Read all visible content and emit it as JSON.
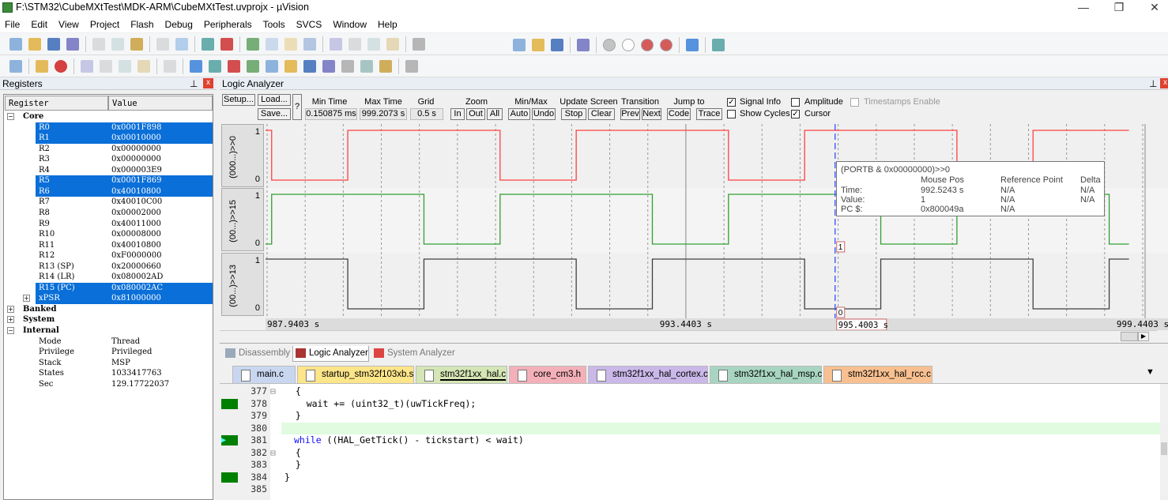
{
  "window": {
    "title": "F:\\STM32\\CubeMXtTest\\MDK-ARM\\CubeMXtTest.uvprojx - µVision",
    "min": "—",
    "max": "❐",
    "close": "✕"
  },
  "menu": [
    "File",
    "Edit",
    "View",
    "Project",
    "Flash",
    "Debug",
    "Peripherals",
    "Tools",
    "SVCS",
    "Window",
    "Help"
  ],
  "toolbar1_icons": [
    "new-file-icon",
    "open-icon",
    "save-icon",
    "save-all-icon",
    "|",
    "cut-icon",
    "copy-icon",
    "paste-icon",
    "|",
    "undo-icon",
    "redo-icon",
    "|",
    "back-icon",
    "forward-icon",
    "|",
    "bookmark-icon",
    "prev-bookmark-icon",
    "next-bookmark-icon",
    "clear-bookmarks-icon",
    "|",
    "indent-icon",
    "unindent-icon",
    "comment-icon",
    "uncomment-icon",
    "|",
    "find-in-files-icon"
  ],
  "toolbar1_right_icons": [
    "find-dropdown-icon",
    "incremental-find-icon",
    "debug-session-icon",
    "|",
    "start-debug-icon",
    "|",
    "breakpoint-icon",
    "disabled-breakpoint-icon",
    "kill-breakpoints-icon",
    "kill-all-icon",
    "|",
    "window-layout-icon",
    "|",
    "configure-icon"
  ],
  "toolbar2_icons": [
    "reset-icon",
    "|",
    "run-icon",
    "stop-icon",
    "|",
    "step-into-icon",
    "step-over-icon",
    "step-out-icon",
    "run-to-cursor-icon",
    "|",
    "show-next-statement-icon",
    "|",
    "command-window-icon",
    "disassembly-window-icon",
    "symbols-window-icon",
    "registers-window-icon",
    "call-stack-icon",
    "watch-window-icon",
    "memory-window-icon",
    "serial-window-icon",
    "analysis-window-icon",
    "trace-window-icon",
    "system-viewer-icon",
    "|",
    "toolbox-icon"
  ],
  "registers": {
    "title": "Registers",
    "pin": "📌",
    "close": "x",
    "col_register": "Register",
    "col_value": "Value",
    "rows": [
      {
        "type": "group",
        "name": "Core",
        "expander": "−"
      },
      {
        "name": "R0",
        "value": "0x0001F898",
        "selected": true
      },
      {
        "name": "R1",
        "value": "0x00010000",
        "selected": true
      },
      {
        "name": "R2",
        "value": "0x00000000"
      },
      {
        "name": "R3",
        "value": "0x00000000"
      },
      {
        "name": "R4",
        "value": "0x000003E9"
      },
      {
        "name": "R5",
        "value": "0x0001F869",
        "selected": true
      },
      {
        "name": "R6",
        "value": "0x40010800",
        "selected": true
      },
      {
        "name": "R7",
        "value": "0x40010C00"
      },
      {
        "name": "R8",
        "value": "0x00002000"
      },
      {
        "name": "R9",
        "value": "0x40011000"
      },
      {
        "name": "R10",
        "value": "0x00008000"
      },
      {
        "name": "R11",
        "value": "0x40010800"
      },
      {
        "name": "R12",
        "value": "0xF0000000"
      },
      {
        "name": "R13 (SP)",
        "value": "0x20000660"
      },
      {
        "name": "R14 (LR)",
        "value": "0x080002AD"
      },
      {
        "name": "R15 (PC)",
        "value": "0x080002AC",
        "selected": true
      },
      {
        "name": "xPSR",
        "value": "0x81000000",
        "selected": true,
        "expander": "+"
      },
      {
        "type": "group",
        "name": "Banked",
        "expander": "+"
      },
      {
        "type": "group",
        "name": "System",
        "expander": "+"
      },
      {
        "type": "group",
        "name": "Internal",
        "expander": "−"
      },
      {
        "name": "Mode",
        "value": "Thread"
      },
      {
        "name": "Privilege",
        "value": "Privileged"
      },
      {
        "name": "Stack",
        "value": "MSP"
      },
      {
        "name": "States",
        "value": "1033417763"
      },
      {
        "name": "Sec",
        "value": "129.17722037"
      }
    ]
  },
  "logic_analyzer": {
    "title": "Logic Analyzer",
    "pin": "📌",
    "close": "x",
    "setup": "Setup...",
    "load": "Load...",
    "save": "Save...",
    "help": "?",
    "min_time_label": "Min Time",
    "min_time": "0.150875 ms",
    "max_time_label": "Max Time",
    "max_time": "999.2073 s",
    "grid_label": "Grid",
    "grid": "0.5 s",
    "zoom_label": "Zoom",
    "zoom_in": "In",
    "zoom_out": "Out",
    "zoom_all": "All",
    "minmax_label": "Min/Max",
    "auto": "Auto",
    "undo": "Undo",
    "update_label": "Update Screen",
    "stop": "Stop",
    "clear": "Clear",
    "transition_label": "Transition",
    "prev": "Prev",
    "next": "Next",
    "jump_label": "Jump to",
    "code": "Code",
    "trace": "Trace",
    "signal_info": {
      "label": "Signal Info",
      "checked": true
    },
    "amplitude": {
      "label": "Amplitude",
      "checked": false
    },
    "timestamps": {
      "label": "Timestamps Enable",
      "checked": false,
      "disabled": true
    },
    "show_cycles": {
      "label": "Show Cycles",
      "checked": false
    },
    "cursor": {
      "label": "Cursor",
      "checked": true
    },
    "channels": [
      {
        "label": "(000...)>>0",
        "high": "1",
        "low": "0",
        "color": "#ff4040",
        "initial": 1,
        "edges": [
          988.0,
          989.0,
          991.0,
          992.0,
          994.0,
          995.0,
          997.0,
          998.0
        ]
      },
      {
        "label": "(00...)>>15",
        "high": "1",
        "low": "0",
        "color": "#30a030",
        "initial": 0,
        "edges": [
          988.0,
          990.0,
          991.0,
          993.0,
          994.0,
          996.0,
          997.0,
          999.0
        ]
      },
      {
        "label": "(00...)>>13",
        "high": "1",
        "low": "0",
        "color": "#404040",
        "initial": 1,
        "edges": [
          989.0,
          990.0,
          992.0,
          993.0,
          995.0,
          996.0,
          998.0,
          999.0
        ]
      }
    ],
    "time_start": 987.9403,
    "time_end": 999.4403,
    "data_end": 999.26,
    "axis_left": "987.9403 s",
    "axis_mid": "993.4403 s",
    "axis_mid_value": 993.4403,
    "axis_right": "999.4403 s",
    "cursor_time": 995.4003,
    "cursor_label": "995.4003 s",
    "cursor_val_ch2": "1",
    "cursor_val_ch3": "0",
    "cursor_color": "#2040ff",
    "tooltip": {
      "expr": "(PORTB & 0x00000000)>>0",
      "h_mouse": "Mouse Pos",
      "h_ref": "Reference Point",
      "h_delta": "Delta",
      "time_label": "Time:",
      "time_mouse": "992.5243 s",
      "time_ref": "N/A",
      "time_delta": "N/A",
      "value_label": "Value:",
      "value_mouse": "1",
      "value_ref": "N/A",
      "value_delta": "N/A",
      "pc_label": "PC $:",
      "pc_mouse": "0x800049a",
      "pc_ref": "N/A"
    }
  },
  "view_tabs": [
    "Disassembly",
    "Logic Analyzer",
    "System Analyzer"
  ],
  "file_tabs": [
    {
      "name": "main.c",
      "color": "#c8d6f0"
    },
    {
      "name": "startup_stm32f103xb.s",
      "color": "#fde58a"
    },
    {
      "name": "stm32f1xx_hal.c",
      "color": "#d4e6b5",
      "active": true
    },
    {
      "name": "core_cm3.h",
      "color": "#f4b0b8"
    },
    {
      "name": "stm32f1xx_hal_cortex.c",
      "color": "#c9b8e8"
    },
    {
      "name": "stm32f1xx_hal_msp.c",
      "color": "#a8d5c2"
    },
    {
      "name": "stm32f1xx_hal_rcc.c",
      "color": "#f8c090"
    }
  ],
  "code": [
    {
      "n": "377",
      "fold": "⊟",
      "text": "  {"
    },
    {
      "n": "378",
      "text": "    wait += (uint32_t)(uwTickFreq);",
      "exec": true
    },
    {
      "n": "379",
      "text": "  }"
    },
    {
      "n": "380",
      "text": "",
      "current": true
    },
    {
      "n": "381",
      "kw": "while",
      "text": " ((HAL_GetTick() - tickstart) < wait)",
      "exec": true,
      "arrow": true
    },
    {
      "n": "382",
      "fold": "⊟",
      "text": "  {"
    },
    {
      "n": "383",
      "text": "  }"
    },
    {
      "n": "384",
      "text": "}",
      "exec": true
    },
    {
      "n": "385",
      "text": ""
    }
  ]
}
